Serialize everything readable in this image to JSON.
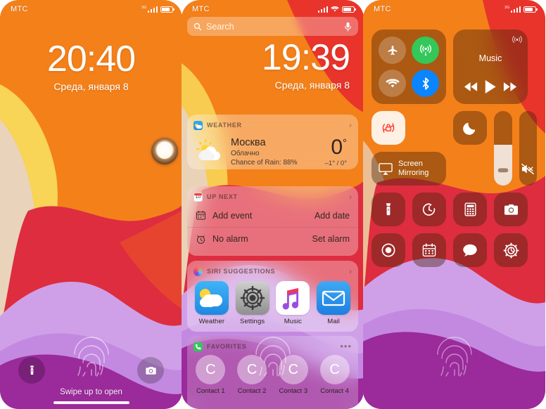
{
  "panel1": {
    "name": "lock-screen",
    "statusbar": {
      "carrier": "МТС",
      "network_label": "3G",
      "battery_level": "78"
    },
    "clock": {
      "time": "20:40",
      "date": "Среда, января 8"
    },
    "bottom": {
      "flashlight_icon": "flashlight-icon",
      "camera_icon": "camera-icon",
      "swipe_hint": "Swipe up to open"
    },
    "fingerprint_icon": "fingerprint-icon",
    "knob_icon": "home-button-knob"
  },
  "panel2": {
    "name": "today-view",
    "statusbar": {
      "carrier": "МТС",
      "battery_level": "78"
    },
    "search": {
      "placeholder": "Search",
      "icon": "search-icon",
      "mic_icon": "microphone-icon"
    },
    "clock": {
      "time": "19:39",
      "date": "Среда, января 8"
    },
    "widgets": {
      "weather": {
        "title": "WEATHER",
        "icon": "weather-app-icon",
        "chevron": "›",
        "city": "Москва",
        "condition": "Облачно",
        "rain": "Chance of Rain: 88%",
        "temp": "0",
        "degree": "°",
        "high_low": "–1° / 0°",
        "condition_icon": "sun-behind-cloud-icon"
      },
      "upnext": {
        "title": "UP NEXT",
        "icon": "calendar-app-icon",
        "icon_day": "10",
        "chevron": "›",
        "rows": [
          {
            "label": "Add event",
            "action": "Add date",
            "icon": "calendar-icon"
          },
          {
            "label": "No alarm",
            "action": "Set alarm",
            "icon": "alarm-clock-icon"
          }
        ]
      },
      "siri": {
        "title": "SIRI SUGGESTIONS",
        "icon": "siri-icon",
        "chevron": "›",
        "apps": [
          {
            "name": "Weather",
            "icon": "weather-app-icon"
          },
          {
            "name": "Settings",
            "icon": "settings-app-icon"
          },
          {
            "name": "Music",
            "icon": "music-app-icon"
          },
          {
            "name": "Mail",
            "icon": "mail-app-icon"
          }
        ]
      },
      "favorites": {
        "title": "FAVORITES",
        "icon": "phone-app-icon",
        "more": "•••",
        "contacts": [
          {
            "name": "Contact 1",
            "initial": "C"
          },
          {
            "name": "Contact 2",
            "initial": "C"
          },
          {
            "name": "Contact 3",
            "initial": "C"
          },
          {
            "name": "Contact 4",
            "initial": "C"
          }
        ]
      }
    },
    "fingerprint_icon": "fingerprint-icon"
  },
  "panel3": {
    "name": "control-center",
    "statusbar": {
      "carrier": "МТС",
      "network_label": "3G",
      "battery_level": "78"
    },
    "connectivity": [
      {
        "name": "airplane-mode-toggle",
        "icon": "airplane-icon",
        "state": "off"
      },
      {
        "name": "cellular-data-toggle",
        "icon": "cellular-antenna-icon",
        "state": "on",
        "color": "#34c759"
      },
      {
        "name": "wifi-toggle",
        "icon": "wifi-icon",
        "state": "off"
      },
      {
        "name": "bluetooth-toggle",
        "icon": "bluetooth-icon",
        "state": "on",
        "color": "#0a84ff"
      }
    ],
    "music": {
      "title": "Music",
      "airplay_icon": "airplay-icon",
      "prev_icon": "rewind-icon",
      "play_icon": "play-icon",
      "next_icon": "fast-forward-icon"
    },
    "rotation_lock": {
      "icon": "rotation-lock-icon",
      "state": "on",
      "color": "#ff3b30"
    },
    "do_not_disturb": {
      "icon": "moon-icon",
      "state": "off"
    },
    "screen_mirroring": {
      "label_line1": "Screen",
      "label_line2": "Mirroring",
      "icon": "screen-mirroring-icon"
    },
    "brightness": {
      "name": "brightness-slider",
      "value": 55,
      "icon": "brightness-icon"
    },
    "volume": {
      "name": "volume-slider",
      "value": 0,
      "icon": "speaker-mute-icon"
    },
    "tiles": [
      {
        "name": "flashlight-tile",
        "icon": "flashlight-icon"
      },
      {
        "name": "timer-tile",
        "icon": "timer-icon"
      },
      {
        "name": "calculator-tile",
        "icon": "calculator-icon"
      },
      {
        "name": "camera-tile",
        "icon": "camera-icon"
      },
      {
        "name": "screen-record-tile",
        "icon": "record-icon"
      },
      {
        "name": "calendar-tile",
        "icon": "calendar-icon"
      },
      {
        "name": "messages-tile",
        "icon": "message-bubble-icon"
      },
      {
        "name": "settings-tile",
        "icon": "gear-icon"
      }
    ],
    "fingerprint_icon": "fingerprint-icon"
  },
  "colors": {
    "orange": "#f4801a",
    "red": "#e0323c",
    "yellow": "#f8d457",
    "beige": "#e8d3c0",
    "light_purple": "#cfa0e8",
    "purple": "#9b2a9b",
    "green": "#34c759",
    "blue": "#0a84ff"
  }
}
